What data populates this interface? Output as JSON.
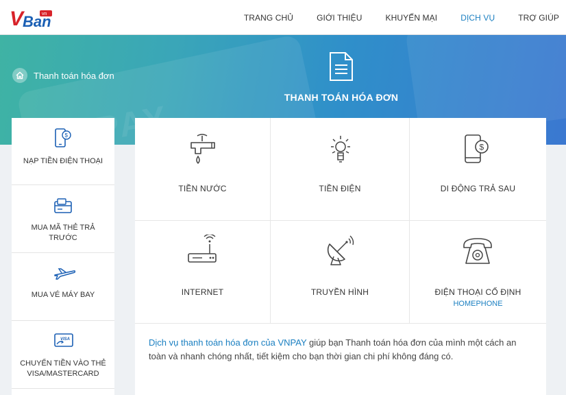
{
  "header": {
    "logo_text": "VBan",
    "logo_badge": "vn",
    "nav": [
      {
        "label": "TRANG CHỦ"
      },
      {
        "label": "GIỚI THIỆU"
      },
      {
        "label": "KHUYẾN MẠI"
      },
      {
        "label": "DỊCH VỤ"
      },
      {
        "label": "TRỢ GIÚP"
      }
    ]
  },
  "banner": {
    "breadcrumb": "Thanh toán hóa đơn",
    "title": "THANH TOÁN HÓA ĐƠN",
    "watermark": "PAY"
  },
  "sidebar": {
    "items": [
      {
        "label": "NẠP TIỀN ĐIỆN THOẠI"
      },
      {
        "label": "MUA MÃ THẺ TRẢ TRƯỚC"
      },
      {
        "label": "MUA VÉ MÁY BAY"
      },
      {
        "label": "CHUYỂN TIỀN VÀO THẺ VISA/MASTERCARD",
        "card_text": "VISA"
      }
    ]
  },
  "services": {
    "items": [
      {
        "label": "TIỀN NƯỚC"
      },
      {
        "label": "TIỀN ĐIỆN"
      },
      {
        "label": "DI ĐỘNG TRẢ SAU"
      },
      {
        "label": "INTERNET"
      },
      {
        "label": "TRUYỀN HÌNH"
      },
      {
        "label": "ĐIỆN THOẠI CỐ ĐỊNH",
        "sublabel": "HOMEPHONE"
      }
    ]
  },
  "description": {
    "link_text": "Dịch vụ thanh toán hóa đơn của VNPAY",
    "text": " giúp bạn Thanh toán hóa đơn của mình một cách an toàn và nhanh chóng nhất, tiết kiệm cho bạn thời gian chi phí không đáng có."
  },
  "colors": {
    "accent": "#1a7fc1",
    "logo_red": "#d8232a",
    "logo_blue": "#1a5fb4"
  }
}
